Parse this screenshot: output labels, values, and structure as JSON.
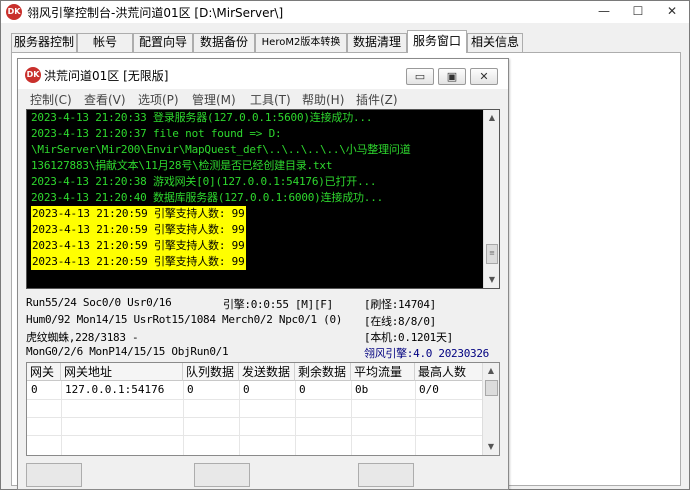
{
  "window": {
    "title": "翎风引擎控制台-洪荒问道01区 [D:\\MirServer\\]",
    "icon_text": "DK"
  },
  "tabs": [
    {
      "label": "服务器控制"
    },
    {
      "label": "帐号"
    },
    {
      "label": "配置向导"
    },
    {
      "label": "数据备份"
    },
    {
      "label": "HeroM2版本转换"
    },
    {
      "label": "数据清理"
    },
    {
      "label": "服务窗口",
      "active": true
    },
    {
      "label": "相关信息"
    }
  ],
  "inner_window": {
    "title": "洪荒问道01区 [无限版]",
    "icon_text": "DK",
    "buttons": {
      "minimize": "▭",
      "maximize": "▣",
      "close": "✕"
    }
  },
  "menu": [
    {
      "label": "控制(C)"
    },
    {
      "label": "查看(V)"
    },
    {
      "label": "选项(P)"
    },
    {
      "label": "管理(M)"
    },
    {
      "label": "工具(T)"
    },
    {
      "label": "帮助(H)"
    },
    {
      "label": "插件(Z)"
    }
  ],
  "log": [
    {
      "text": "2023-4-13 21:20:33 登录服务器(127.0.0.1:5600)连接成功...",
      "highlight": false
    },
    {
      "text": "2023-4-13 21:20:37 file not found => D:",
      "highlight": false
    },
    {
      "text": "\\MirServer\\Mir200\\Envir\\MapQuest_def\\..\\..\\..\\..\\小马整理问道",
      "highlight": false
    },
    {
      "text": "136127883\\捐献文本\\11月28号\\检测是否已经创建目录.txt",
      "highlight": false
    },
    {
      "text": "2023-4-13 21:20:38 游戏网关[0](127.0.0.1:54176)已打开...",
      "highlight": false
    },
    {
      "text": "2023-4-13 21:20:40 数据库服务器(127.0.0.1:6000)连接成功...",
      "highlight": false
    },
    {
      "text": "2023-4-13 21:20:59 引擎支持人数: 99",
      "highlight": true
    },
    {
      "text": "2023-4-13 21:20:59 引擎支持人数: 99",
      "highlight": true
    },
    {
      "text": "2023-4-13 21:20:59 引擎支持人数: 99",
      "highlight": true
    },
    {
      "text": "2023-4-13 21:20:59 引擎支持人数: 99",
      "highlight": true
    }
  ],
  "status": {
    "run": "Run55/24 Soc0/0 Usr0/16",
    "engine": "引擎:0:0:55 [M][F]",
    "refresh": "[刷怪:14704]",
    "hum": "Hum0/92 Mon14/15 UsrRot15/1084 Merch0/2 Npc0/1 (0)",
    "online": "[在线:8/8/0]",
    "monster": "虎纹蜘蛛,228/3183 -",
    "machine": "[本机:0.1201天]",
    "mongen": "MonG0/2/6 MonP14/15/15 ObjRun0/1",
    "version": "翎风引擎:4.0 20230326"
  },
  "gateway_table": {
    "columns": [
      "网关",
      "网关地址",
      "队列数据",
      "发送数据",
      "剩余数据",
      "平均流量",
      "最高人数"
    ],
    "rows": [
      [
        "0",
        "127.0.0.1:54176",
        "0",
        "0",
        "0",
        "0b",
        "0/0"
      ]
    ]
  },
  "colors": {
    "log_text": "#2ed82e",
    "log_bg": "#000000",
    "highlight_bg": "#ffff00",
    "version_text": "#000080"
  }
}
